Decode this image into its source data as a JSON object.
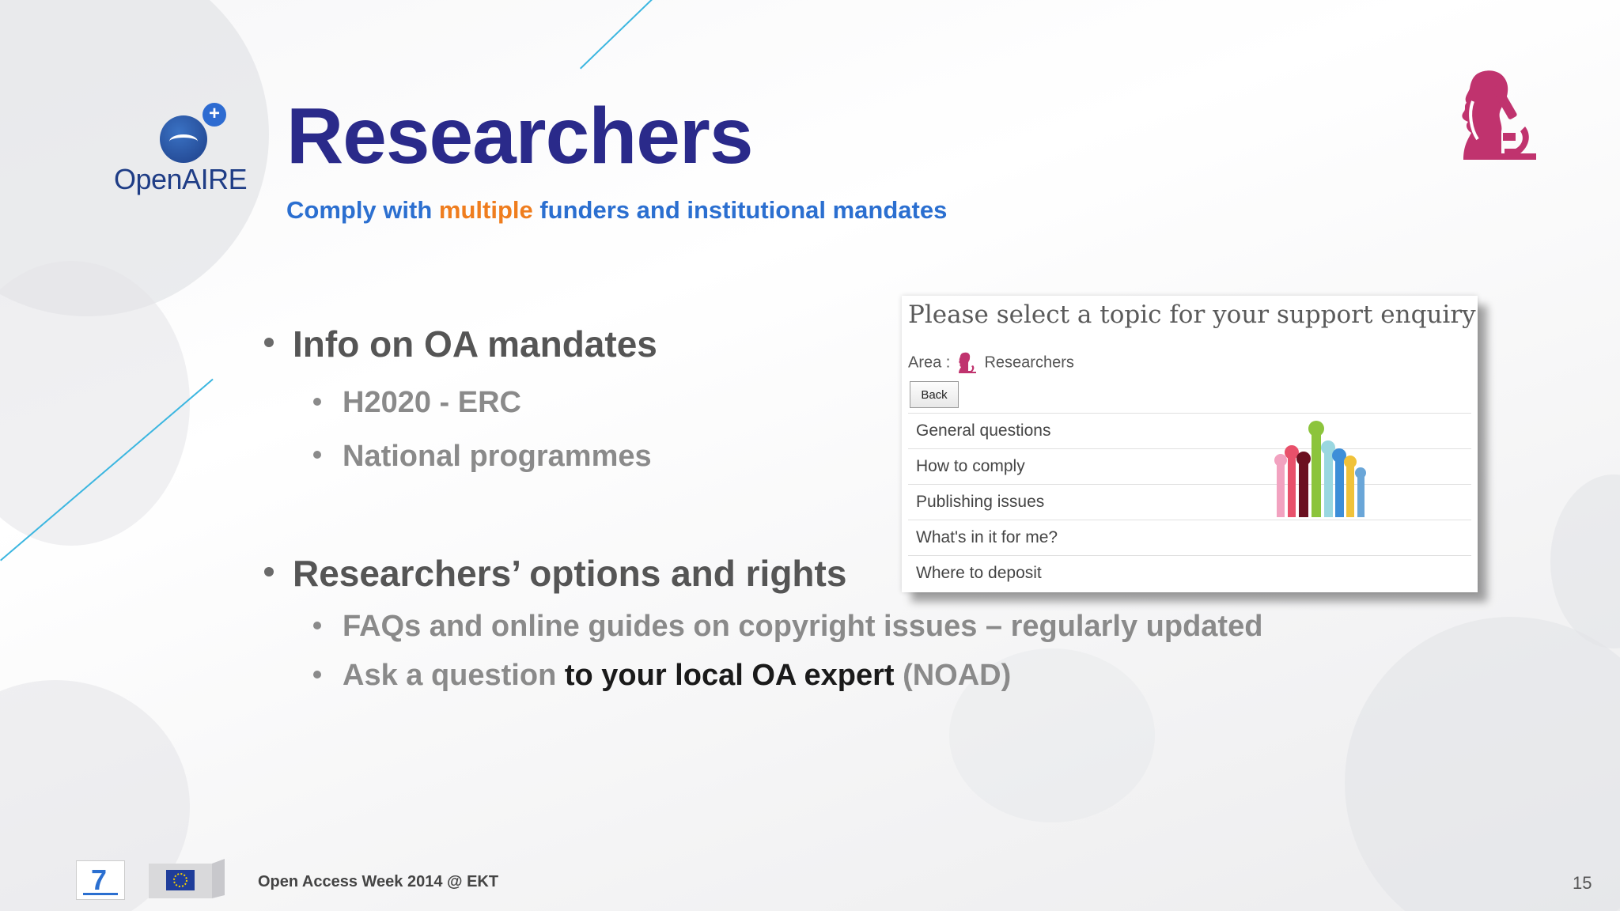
{
  "logo": {
    "text": "OpenAIRE"
  },
  "title": "Researchers",
  "subtitle": {
    "part1": "Comply with ",
    "accent": "multiple",
    "part2": " funders and institutional mandates"
  },
  "bullets": {
    "b1": "Info on OA mandates",
    "b1_1": "H2020 - ERC",
    "b1_2": "National programmes",
    "b2": "Researchers’ options and rights",
    "b2_1": "FAQs and online guides on copyright issues – regularly updated",
    "b2_2_a": "Ask a question ",
    "b2_2_b": "to your local OA expert",
    "b2_2_c": " (NOAD)"
  },
  "panel": {
    "title": "Please select a topic for your support enquiry",
    "area_label": "Area :",
    "area_value": "Researchers",
    "back_label": "Back",
    "items": [
      "General questions",
      "How to comply",
      "Publishing issues",
      "What's in it for me?",
      "Where to deposit"
    ]
  },
  "footer": {
    "text": "Open Access Week 2014 @ EKT",
    "page": "15"
  },
  "colors": {
    "title": "#2a2a8a",
    "subtitle": "#2b6fd0",
    "accent": "#ef7d1e",
    "icon": "#c0336e"
  },
  "icons": [
    "openaire-logo",
    "researcher-microscope-icon",
    "raised-hands-image",
    "fp7-logo",
    "eu-flag-logo"
  ]
}
